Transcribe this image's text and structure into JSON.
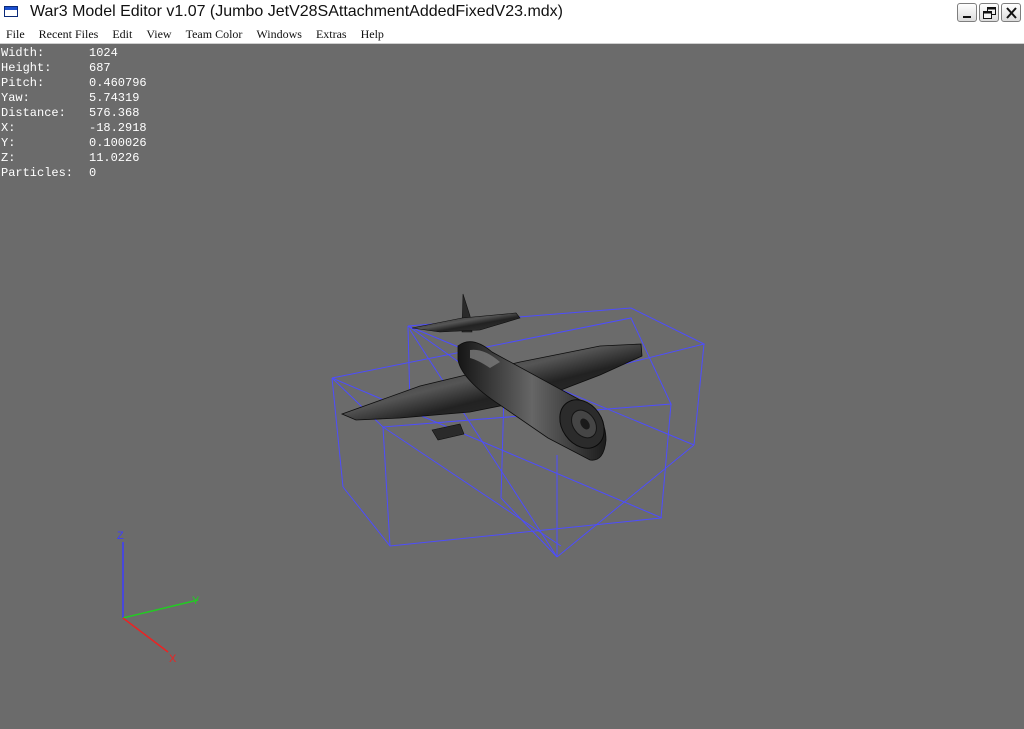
{
  "window": {
    "title": "War3 Model Editor v1.07 (Jumbo JetV28SAttachmentAddedFixedV23.mdx)"
  },
  "menu": {
    "items": [
      {
        "label": "File"
      },
      {
        "label": "Recent Files"
      },
      {
        "label": "Edit"
      },
      {
        "label": "View"
      },
      {
        "label": "Team Color"
      },
      {
        "label": "Windows"
      },
      {
        "label": "Extras"
      },
      {
        "label": "Help"
      }
    ]
  },
  "stats": [
    {
      "label": "Width:",
      "value": "1024"
    },
    {
      "label": "Height:",
      "value": "687"
    },
    {
      "label": "Pitch:",
      "value": "0.460796"
    },
    {
      "label": "Yaw:",
      "value": "5.74319"
    },
    {
      "label": "Distance:",
      "value": "576.368"
    },
    {
      "label": "X:",
      "value": "-18.2918"
    },
    {
      "label": "Y:",
      "value": "0.100026"
    },
    {
      "label": "Z:",
      "value": "11.0226"
    },
    {
      "label": "Particles:",
      "value": "0"
    }
  ],
  "axes": {
    "z_label": "Z",
    "y_label": "Y",
    "x_label": "X",
    "z_color": "#3c3cff",
    "y_color": "#22cc22",
    "x_color": "#ee2222"
  },
  "colors": {
    "viewport_bg": "#6b6b6b",
    "bounds_color": "#4d4dff"
  }
}
